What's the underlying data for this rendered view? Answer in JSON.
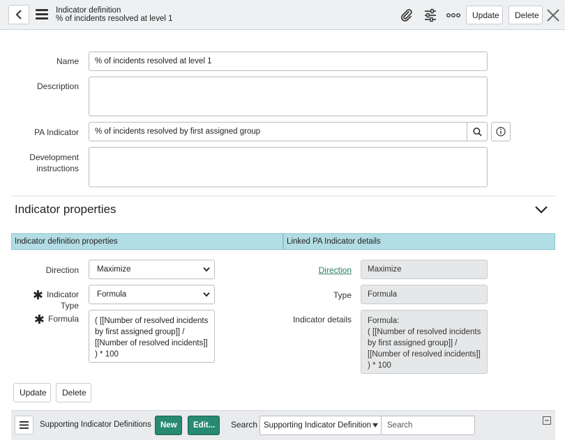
{
  "header": {
    "title": "Indicator definition",
    "subtitle": "% of incidents resolved at level 1",
    "update_label": "Update",
    "delete_label": "Delete"
  },
  "form": {
    "name_label": "Name",
    "name_value": "% of incidents resolved at level 1",
    "description_label": "Description",
    "pa_indicator_label": "PA Indicator",
    "pa_indicator_value": "% of incidents resolved by first assigned group",
    "dev_instructions_label_1": "Development",
    "dev_instructions_label_2": "instructions"
  },
  "section": {
    "title": "Indicator properties",
    "tab_left": "Indicator definition properties",
    "tab_right": "Linked PA Indicator details"
  },
  "left_props": {
    "direction_label": "Direction",
    "direction_value": "Maximize",
    "indicator_type_label": "Indicator Type",
    "indicator_type_value": "Formula",
    "formula_label": "Formula",
    "formula_value": "( [[Number of resolved incidents by first assigned group]] / [[Number of resolved incidents]] ) * 100"
  },
  "right_props": {
    "direction_label": "Direction",
    "direction_value": "Maximize",
    "type_label": "Type",
    "type_value": "Formula",
    "details_label": "Indicator details",
    "details_line1": "Formula:",
    "details_line2": "( [[Number of resolved incidents by first assigned group]] / [[Number of resolved incidents]] ) * 100"
  },
  "actions": {
    "update_label": "Update",
    "delete_label": "Delete"
  },
  "related": {
    "title": "Supporting Indicator Definitions",
    "new_label": "New",
    "edit_label": "Edit...",
    "search_label": "Search",
    "search_field": "Supporting Indicator Definition",
    "search_placeholder": "Search"
  },
  "colors": {
    "accent_green": "#278a71",
    "tab_blue": "#b3dde5",
    "link_green": "#2a7f62"
  }
}
